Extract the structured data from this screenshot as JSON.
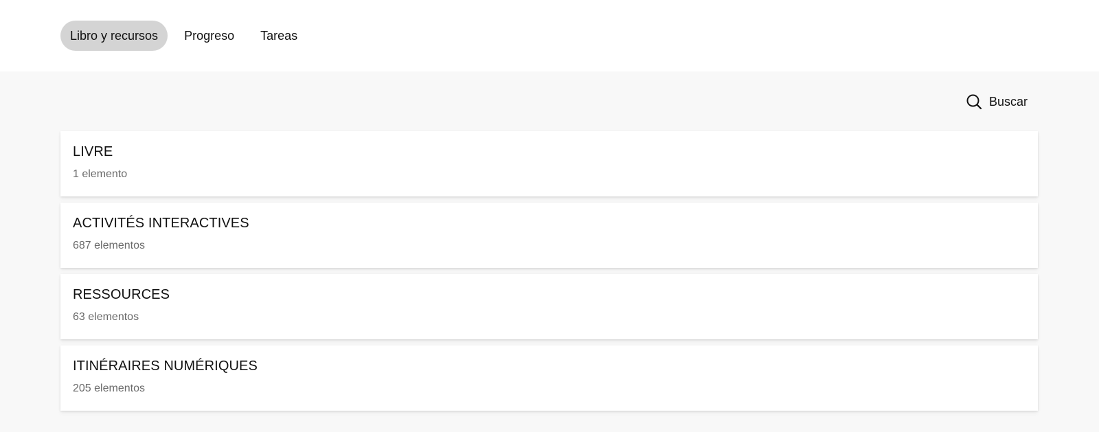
{
  "nav": {
    "tabs": [
      {
        "label": "Libro y recursos",
        "active": true
      },
      {
        "label": "Progreso",
        "active": false
      },
      {
        "label": "Tareas",
        "active": false
      }
    ]
  },
  "search": {
    "label": "Buscar",
    "icon": "search-icon"
  },
  "sections": [
    {
      "title": "LIVRE",
      "count": "1 elemento"
    },
    {
      "title": "ACTIVITÉS INTERACTIVES",
      "count": "687 elementos"
    },
    {
      "title": "RESSOURCES",
      "count": "63 elementos"
    },
    {
      "title": "ITINÉRAIRES NUMÉRIQUES",
      "count": "205 elementos"
    }
  ],
  "colors": {
    "page_background": "#f8f8f8",
    "active_tab_background": "#d4d4d4",
    "card_background": "#ffffff",
    "muted_text": "#6a6a6a"
  }
}
